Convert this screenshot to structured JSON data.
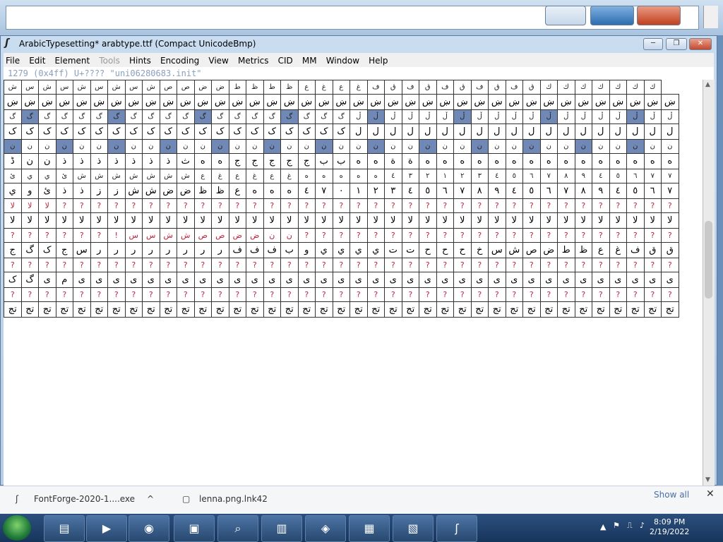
{
  "window": {
    "title": "ArabicTypesetting*  arabtype.ttf (Compact UnicodeBmp)",
    "min_glyph": "─",
    "max_glyph": "❐",
    "close_glyph": "✕"
  },
  "menu": [
    "File",
    "Edit",
    "Element",
    "Tools",
    "Hints",
    "Encoding",
    "View",
    "Metrics",
    "CID",
    "MM",
    "Window",
    "Help"
  ],
  "info_line": "1279 (0x4ff) U+???? \"uni06280683.init\"",
  "glyph_rows": [
    "ش س ش س ش س ش س ش ص ص ض ض ط ظ ط ظ ع غ ع غ ف ق ف ق ف ق ف ق ف ق ك ك ك ك ك ك ك",
    "ښ ښ ښ ښ ښ ښ ښ ښ ښ ښ ښ ښ ښ ښ ښ ښ ښ ښ ښ ښ ښ ښ ښ ښ ښ ښ ښ ښ ښ ښ ښ ښ ښ ښ ښ ښ ښ ښ ښ",
    "گ گ گ گ گ گ گ گ گ گ گ گ گ گ گ گ گ گ گ گ ڵ ڵ ڵ ڵ ڵ ڵ ڵ ڵ ڵ ڵ ڵ ڵ ڵ ڵ ڵ ڵ ڵ ڵ ڵ",
    "ک ک ک ک ک ک ک ک ک ک ک ک ک ک ک ک ک ک ک ک ل ل ل ل ل ل ل ل ل ل ل ل ل ل ل ل ل ل ل",
    "ن ن ن ن ن ن ن ن ن ن ن ن ن ن ن ن ن ن ن ن ن ن ن ن ن ن ن ن ن ن ن ن ن ن ن ن ن ن ن",
    "ڈ ن ن ذ ذ ذ ذ ذ ذ ذ ث ه ه ج ج ج ج ج ب ب ه ه ة ة ه ه ه ه ه ه ه ه ه ه ه ه ه ه ه",
    "ئ ي ي ئ ش ش ش ش ش ش ش ع غ ع غ ع غ ه ه ه ه ه ٤ ٣ ٢ ١ ٢ ٣ ٤ ٥ ٦ ٧ ٨ ٩ ٤ ٥ ٦ ٧ ٧",
    "ي و ئ ذ ذ ز ز ش ش ض ض ظ ظ ع ه ه ه ٤ ٧ ٠ ١ ٢ ٣ ٤ ٥ ٦ ٧ ٨ ٩ ٤ ٥ ٦ ٧ ٨ ٩ ٤ ٥ ٦ ٧",
    "لا لا لا ? ? ? ? ? ? ? ? ? ? ? ? ? ? ? ? ? ? ? ? ? ? ? ? ? ? ? ? ? ? ? ? ? ? ? ?",
    "لا لا لا لا لا لا لا لا لا لا لا لا لا لا لا لا لا لا لا لا لا لا لا لا لا لا لا لا لا لا لا لا لا لا لا لا لا لا لا",
    "? ? ? ? ? ? ! س س ش ش ص ص ض ض ن ن ? ? ? ? ? ? ? ? ? ? ? ? ? ? ? ? ? ? ? ? ? ?",
    "ج گ ک ج س ر ر ر ر ر ر ر ر ف ف ف ب و ي ي ي ي ت ت ح ح ح خ س ش ص ض ط ظ ع غ ف ق ق",
    "? ? ? ? ? ? ? ? ? ? ? ? ? ? ? ? ? ? ? ? ? ? ? ? ? ? ? ? ? ? ? ? ? ? ? ? ? ? ?",
    "ک گ ی م ی ی ی ی ی ی ی ی ی ی ی ی ی ی ی ی ی ی ی ی ی ی ی ی ی ی ی ی ی ی ی ی ی ی ی",
    "? ? ? ? ? ? ? ? ? ? ? ? ? ? ? ? ? ? ? ? ? ? ? ? ? ? ? ? ? ? ? ? ? ? ? ? ? ? ?",
    "تج تج تج تج تج تج تج تج تج تج تج تج تج تج تج تج تج تج تج تج تج تج تج تج تج تج تج تج تج تج تج تج تج تج تج تج تج تج تج"
  ],
  "downloads": [
    {
      "label": "FontForge-2020-1....exe",
      "caret": "^"
    },
    {
      "label": "lenna.png.lnk42"
    }
  ],
  "downloads_show_all": "Show all",
  "downloads_close": "✕",
  "taskbar": {
    "time": "8:09 PM",
    "date": "2/19/2022",
    "tray_arrow": "▲"
  }
}
